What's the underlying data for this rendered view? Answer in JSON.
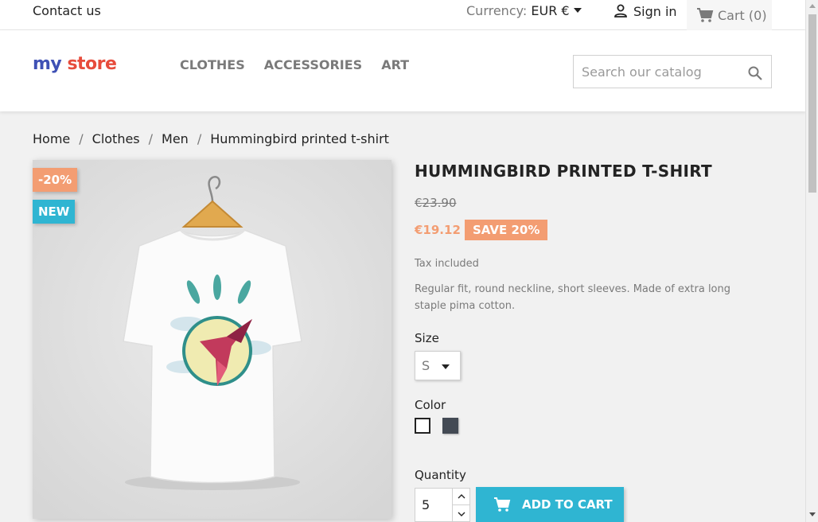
{
  "topbar": {
    "contact": "Contact us",
    "currency_label": "Currency:",
    "currency_value": "EUR €",
    "signin": "Sign in",
    "cart": "Cart (0)"
  },
  "header": {
    "logo_part1": "my",
    "logo_part2": "store",
    "menu": [
      "CLOTHES",
      "ACCESSORIES",
      "ART"
    ],
    "search_placeholder": "Search our catalog"
  },
  "breadcrumb": [
    "Home",
    "Clothes",
    "Men",
    "Hummingbird printed t-shirt"
  ],
  "product": {
    "flag_discount": "-20%",
    "flag_new": "NEW",
    "title": "HUMMINGBIRD PRINTED T-SHIRT",
    "old_price": "€23.90",
    "price": "€19.12",
    "save": "SAVE 20%",
    "tax": "Tax included",
    "description": "Regular fit, round neckline, short sleeves. Made of extra long staple pima cotton.",
    "size_label": "Size",
    "size_value": "S",
    "color_label": "Color",
    "colors": [
      "#ffffff",
      "#434a54"
    ],
    "quantity_label": "Quantity",
    "quantity_value": "5",
    "add_to_cart": "ADD TO CART"
  },
  "colors": {
    "accent": "#2fb5d2",
    "discount": "#f39d72"
  }
}
